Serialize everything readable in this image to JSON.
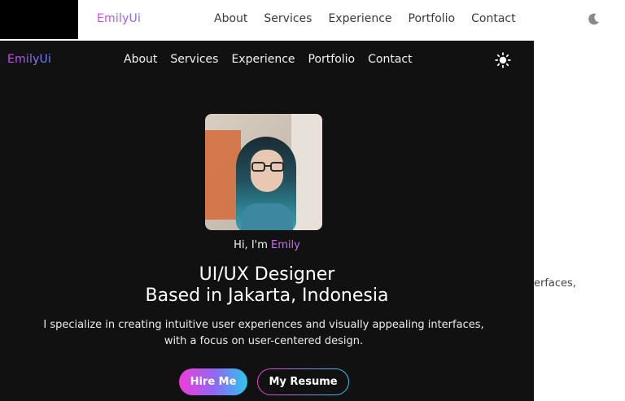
{
  "light_nav": {
    "logo": "EmilyUi",
    "links": [
      "About",
      "Services",
      "Experience",
      "Portfolio",
      "Contact"
    ],
    "theme_toggle_icon": "moon-icon",
    "partial_text": "erfaces,"
  },
  "dark_nav": {
    "logo": "EmilyUi",
    "links": [
      "About",
      "Services",
      "Experience",
      "Portfolio",
      "Contact"
    ],
    "theme_toggle_icon": "sun-icon"
  },
  "hero": {
    "greeting_prefix": "Hi, I'm ",
    "greeting_name": "Emily",
    "headline_line1": "UI/UX Designer",
    "headline_line2": "Based in Jakarta, Indonesia",
    "description_line1": "I specialize in creating intuitive user experiences and visually appealing interfaces,",
    "description_line2": "with a focus on user-centered design.",
    "hire_button": "Hire Me",
    "resume_button": "My Resume"
  },
  "colors": {
    "dark_background": "#111111",
    "accent_pink": "#f03cd9",
    "accent_cyan": "#2bc7ee",
    "name_accent": "#c86cf8"
  }
}
